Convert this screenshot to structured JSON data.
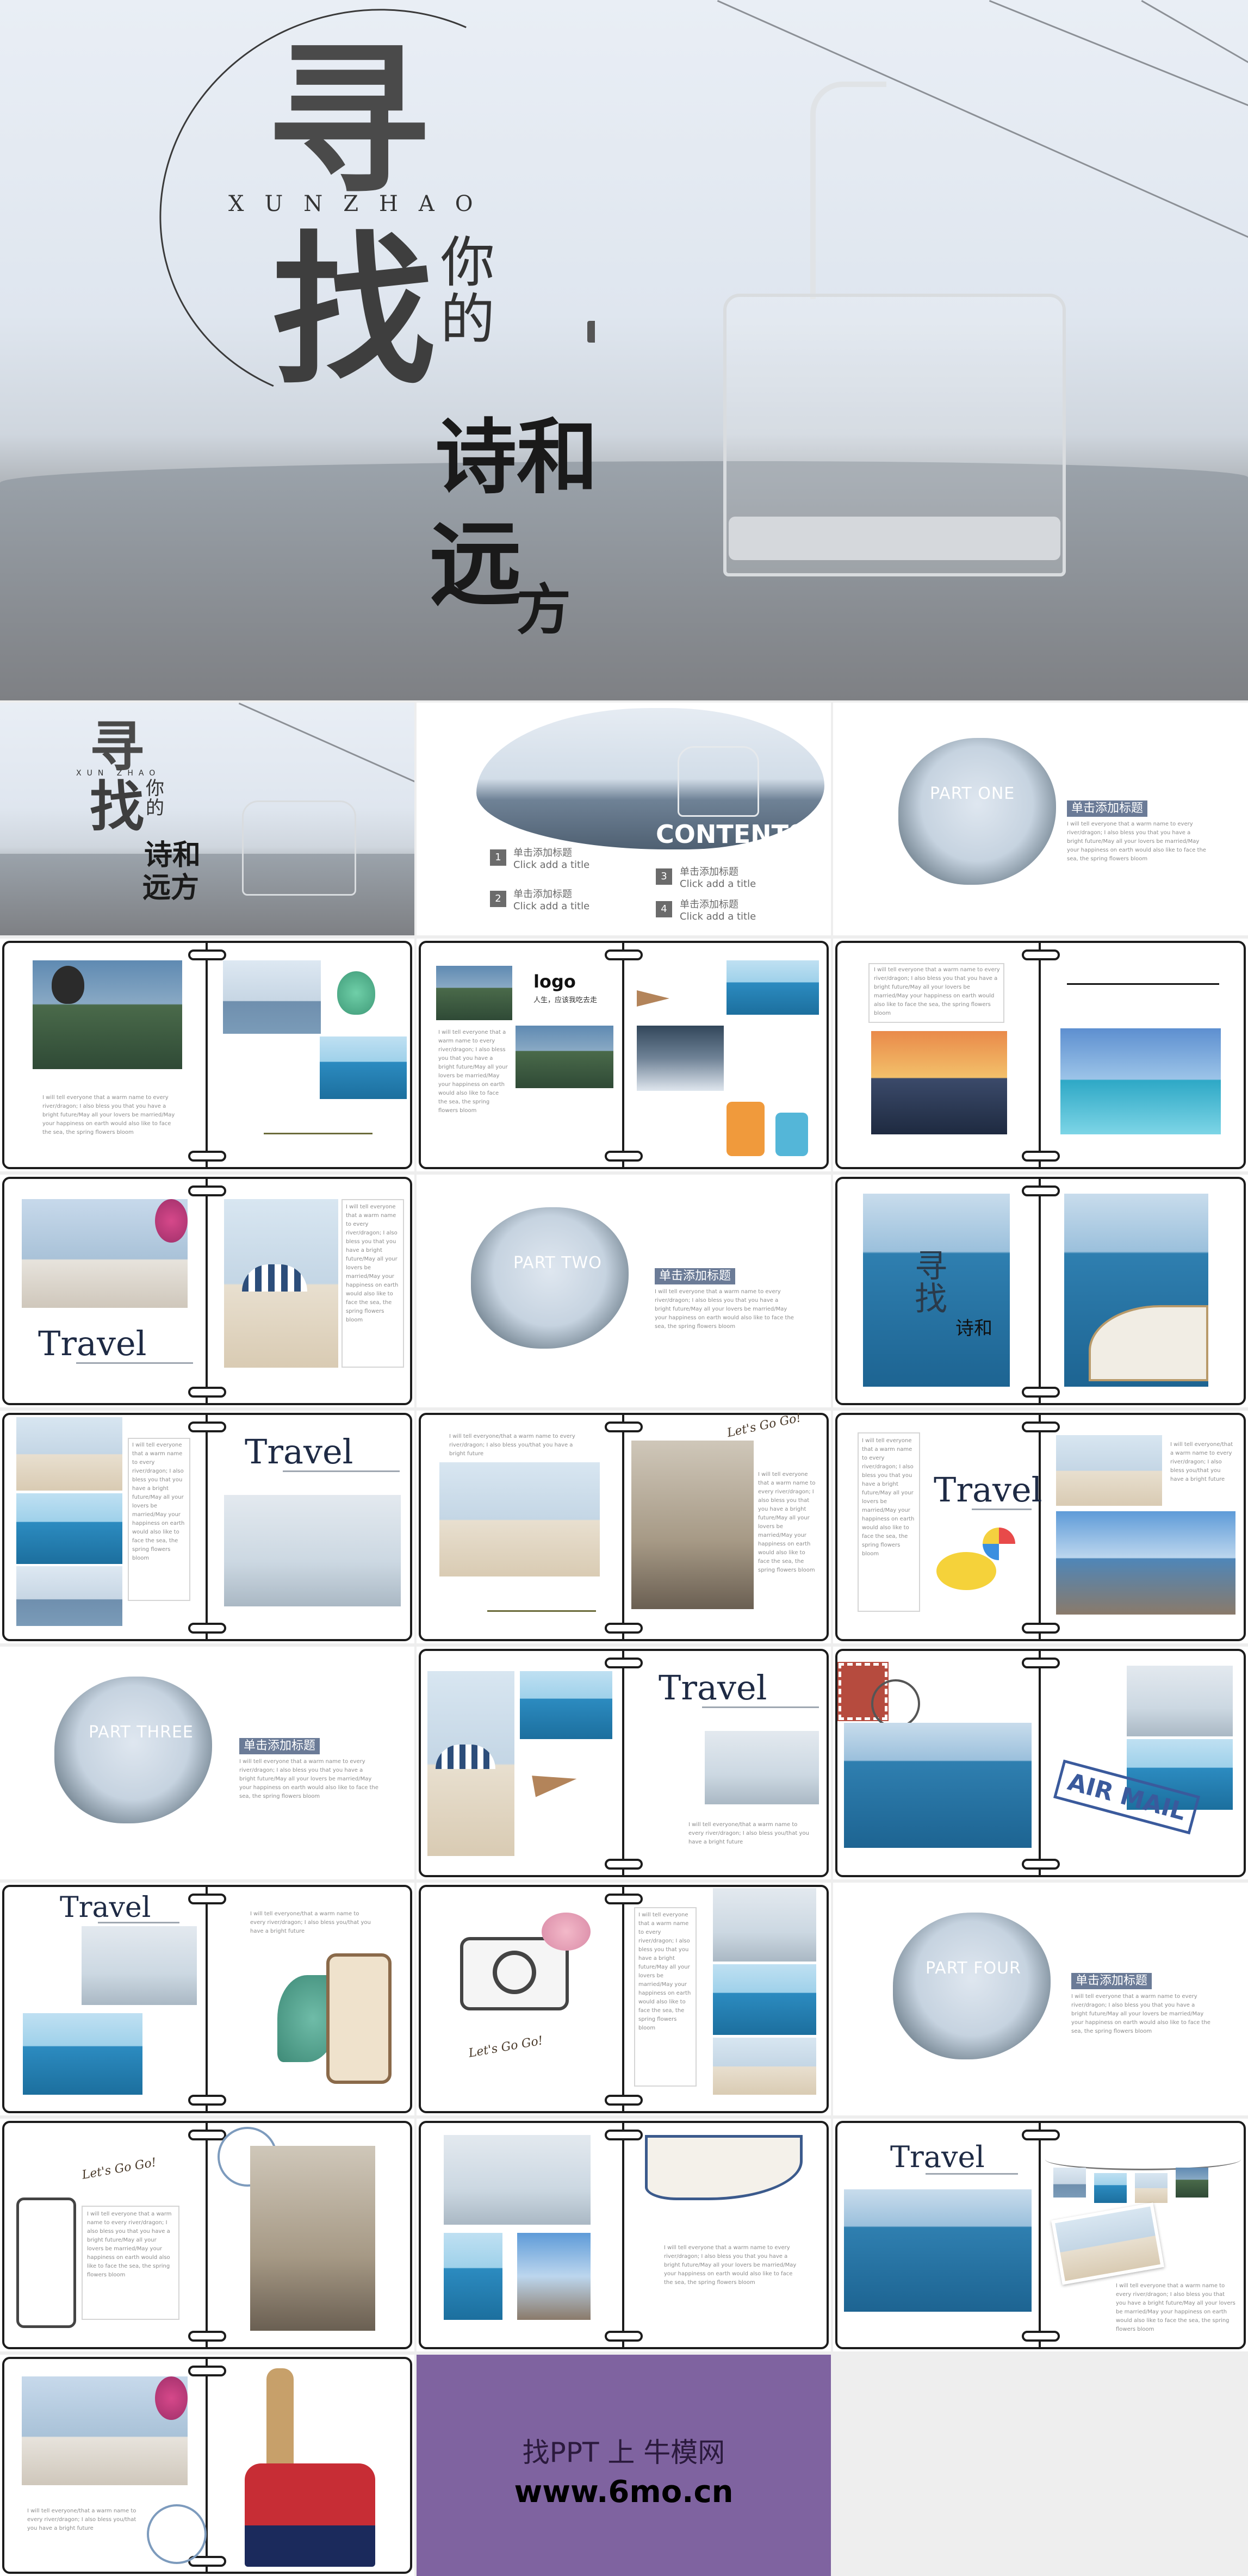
{
  "cover": {
    "big1": "寻",
    "big2": "找",
    "small_top": "你的",
    "subtitle_mid": "诗和",
    "subtitle_bottom1": "远",
    "subtitle_bottom2": "方",
    "pinyin": "XUNZHAO"
  },
  "thumb_cover": {
    "big1": "寻",
    "big2": "找",
    "small": "你的",
    "sub1": "诗和",
    "sub2": "远方",
    "pinyin": "XUN ZHAO"
  },
  "contents": {
    "title": "CONTENTS",
    "items": [
      {
        "num": "1",
        "cn": "单击添加标题",
        "en": "Click add a title"
      },
      {
        "num": "2",
        "cn": "单击添加标题",
        "en": "Click add a title"
      },
      {
        "num": "3",
        "cn": "单击添加标题",
        "en": "Click add a title"
      },
      {
        "num": "4",
        "cn": "单击添加标题",
        "en": "Click add a title"
      }
    ]
  },
  "parts": [
    {
      "label": "PART ONE",
      "tag": "单击添加标题"
    },
    {
      "label": "PART TWO",
      "tag": "单击添加标题"
    },
    {
      "label": "PART THREE",
      "tag": "单击添加标题"
    },
    {
      "label": "PART FOUR",
      "tag": "单击添加标题"
    }
  ],
  "body_text": "I will tell everyone that a warm name to every river/dragon; I also bless you that you have a bright future/May all your lovers be married/May your happiness on earth would also like to face the sea, the spring flowers bloom",
  "short_text": "I will tell everyone/that a warm name to every river/dragon; I also bless you/that you have a bright future",
  "travel": "Travel",
  "logo": {
    "text": "logo",
    "sub": "人生，应该我吃去走"
  },
  "letsgo": "Let's Go Go!",
  "airmail": "AIR MAIL",
  "thumb_mini": {
    "big1": "寻",
    "big2": "找",
    "sub": "诗和"
  },
  "promo": {
    "line1": "找PPT 上 牛模网",
    "line2": "www.6mo.cn",
    "bg": "#7f63a0"
  },
  "colors": {
    "accent": "#6b7b97",
    "navy": "#1e2a44",
    "purple": "#7f63a0"
  }
}
